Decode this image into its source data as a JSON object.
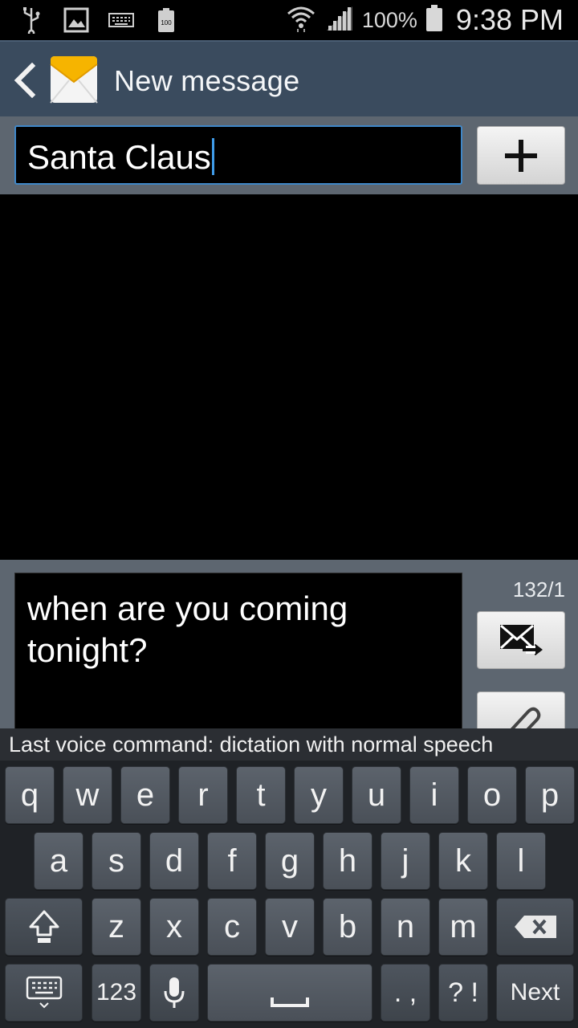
{
  "status_bar": {
    "icons_left": [
      "usb-icon",
      "image-icon",
      "keyboard-icon",
      "battery-100-icon"
    ],
    "battery_small_label": "100",
    "battery_percent": "100%",
    "time": "9:38 PM"
  },
  "action_bar": {
    "title": "New message"
  },
  "recipient": {
    "value": "Santa Claus",
    "add_label": "+"
  },
  "compose": {
    "message": "when are you coming tonight?",
    "counter": "132/1"
  },
  "voice_strip": {
    "text": "Last voice command: dictation with normal speech"
  },
  "keyboard": {
    "row1": [
      "q",
      "w",
      "e",
      "r",
      "t",
      "y",
      "u",
      "i",
      "o",
      "p"
    ],
    "row2": [
      "a",
      "s",
      "d",
      "f",
      "g",
      "h",
      "j",
      "k",
      "l"
    ],
    "row3": [
      "z",
      "x",
      "c",
      "v",
      "b",
      "n",
      "m"
    ],
    "num_label": "123",
    "punct_label": ". ,",
    "symbols_label": "? !",
    "next_label": "Next"
  },
  "colors": {
    "action_bar": "#3a4b5e",
    "field_focus": "#3f87c8",
    "panel": "#5d6670"
  }
}
